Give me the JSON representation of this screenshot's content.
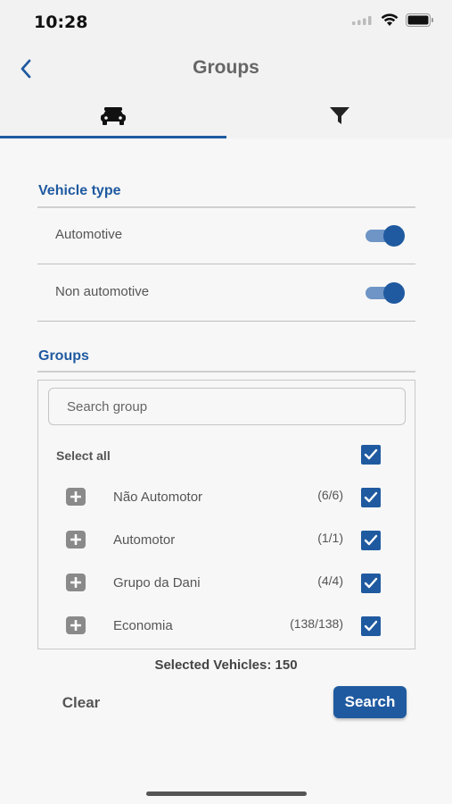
{
  "status_bar": {
    "time": "10:28"
  },
  "nav": {
    "title": "Groups"
  },
  "tabs": [
    {
      "name": "vehicles",
      "icon": "car-icon"
    },
    {
      "name": "filter",
      "icon": "filter-icon"
    }
  ],
  "vehicle_type": {
    "title": "Vehicle type",
    "options": [
      {
        "label": "Automotive",
        "enabled": true
      },
      {
        "label": "Non automotive",
        "enabled": true
      }
    ]
  },
  "groups": {
    "title": "Groups",
    "search_placeholder": "Search group",
    "select_all_label": "Select all",
    "select_all_checked": true,
    "items": [
      {
        "name": "Não Automotor",
        "count": "(6/6)",
        "checked": true
      },
      {
        "name": "Automotor",
        "count": "(1/1)",
        "checked": true
      },
      {
        "name": "Grupo da Dani",
        "count": "(4/4)",
        "checked": true
      },
      {
        "name": "Economia",
        "count": "(138/138)",
        "checked": true
      }
    ]
  },
  "footer": {
    "selected_vehicles": "Selected Vehicles: 150",
    "clear_label": "Clear",
    "search_label": "Search"
  },
  "colors": {
    "accent": "#1f5aa0",
    "toggle_track": "#6f95c6"
  }
}
